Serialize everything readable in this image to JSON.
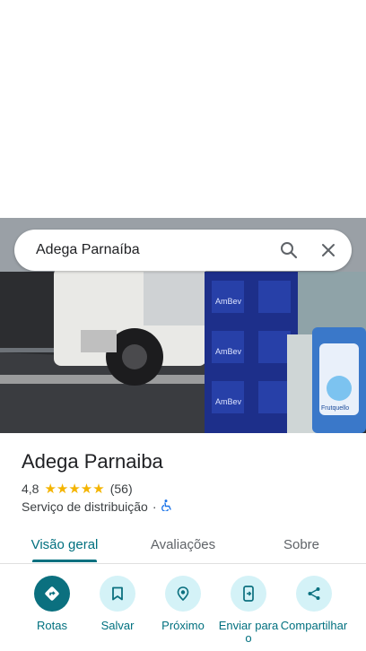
{
  "search": {
    "query": "Adega Parnaíba"
  },
  "place": {
    "name": "Adega Parnaiba",
    "rating": "4,8",
    "stars": "★★★★★",
    "review_count": "(56)",
    "category": "Serviço de distribuição",
    "separator": "·"
  },
  "tabs": [
    {
      "label": "Visão geral",
      "active": true
    },
    {
      "label": "Avaliações",
      "active": false
    },
    {
      "label": "Sobre",
      "active": false
    }
  ],
  "actions": [
    {
      "label": "Rotas",
      "icon": "directions-icon"
    },
    {
      "label": "Salvar",
      "icon": "bookmark-icon"
    },
    {
      "label": "Próximo",
      "icon": "nearby-icon"
    },
    {
      "label": "Enviar para o",
      "icon": "send-to-phone-icon"
    },
    {
      "label": "Compartilhar",
      "icon": "share-icon"
    }
  ],
  "photo_text": {
    "crate_brand": "AmBev",
    "sign_brand": "Frutquello"
  },
  "colors": {
    "accent": "#00707f",
    "star": "#f4b400",
    "chip_bg": "#d4f2f7"
  }
}
